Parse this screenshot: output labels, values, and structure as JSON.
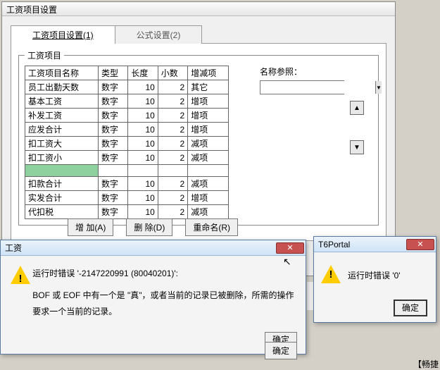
{
  "mainWindow": {
    "title": "工资项目设置",
    "tabs": [
      {
        "label": "工资项目设置(1)",
        "active": true
      },
      {
        "label": "公式设置(2)",
        "active": false
      }
    ],
    "groupLabel": "工资项目",
    "table": {
      "headers": [
        "工资项目名称",
        "类型",
        "长度",
        "小数",
        "增减项"
      ],
      "rows": [
        {
          "name": "员工出勤天数",
          "type": "数字",
          "len": "10",
          "dec": "2",
          "kind": "其它"
        },
        {
          "name": "基本工资",
          "type": "数字",
          "len": "10",
          "dec": "2",
          "kind": "增项"
        },
        {
          "name": "补发工资",
          "type": "数字",
          "len": "10",
          "dec": "2",
          "kind": "增项"
        },
        {
          "name": "应发合计",
          "type": "数字",
          "len": "10",
          "dec": "2",
          "kind": "增项"
        },
        {
          "name": "扣工资大",
          "type": "数字",
          "len": "10",
          "dec": "2",
          "kind": "减项"
        },
        {
          "name": "扣工资小",
          "type": "数字",
          "len": "10",
          "dec": "2",
          "kind": "减项"
        },
        {
          "name": "",
          "type": "",
          "len": "",
          "dec": "",
          "kind": "",
          "selected": true
        },
        {
          "name": "扣款合计",
          "type": "数字",
          "len": "10",
          "dec": "2",
          "kind": "减项"
        },
        {
          "name": "实发合计",
          "type": "数字",
          "len": "10",
          "dec": "2",
          "kind": "增项"
        },
        {
          "name": "代扣税",
          "type": "数字",
          "len": "10",
          "dec": "2",
          "kind": "减项"
        }
      ]
    },
    "refLabel": "名称参照：",
    "arrowUp": "▲",
    "arrowDown": "▼",
    "buttons": {
      "add": "增 加(A)",
      "del": "删 除(D)",
      "rename": "重命名(R)"
    }
  },
  "dialog1": {
    "title": "工资",
    "heading": "运行时错误 '-2147220991 (80040201)':",
    "body": "BOF 或 EOF 中有一个是 \"真\"，或者当前的记录已被删除，所需的操作要求一个当前的记录。",
    "ok": "确定"
  },
  "dialog2": {
    "title": "T6Portal",
    "body": "运行时错误 '0'",
    "ok": "确定"
  },
  "bottomConfirm": "确定",
  "cornerTag": "【畅捷",
  "cursor": "↖"
}
